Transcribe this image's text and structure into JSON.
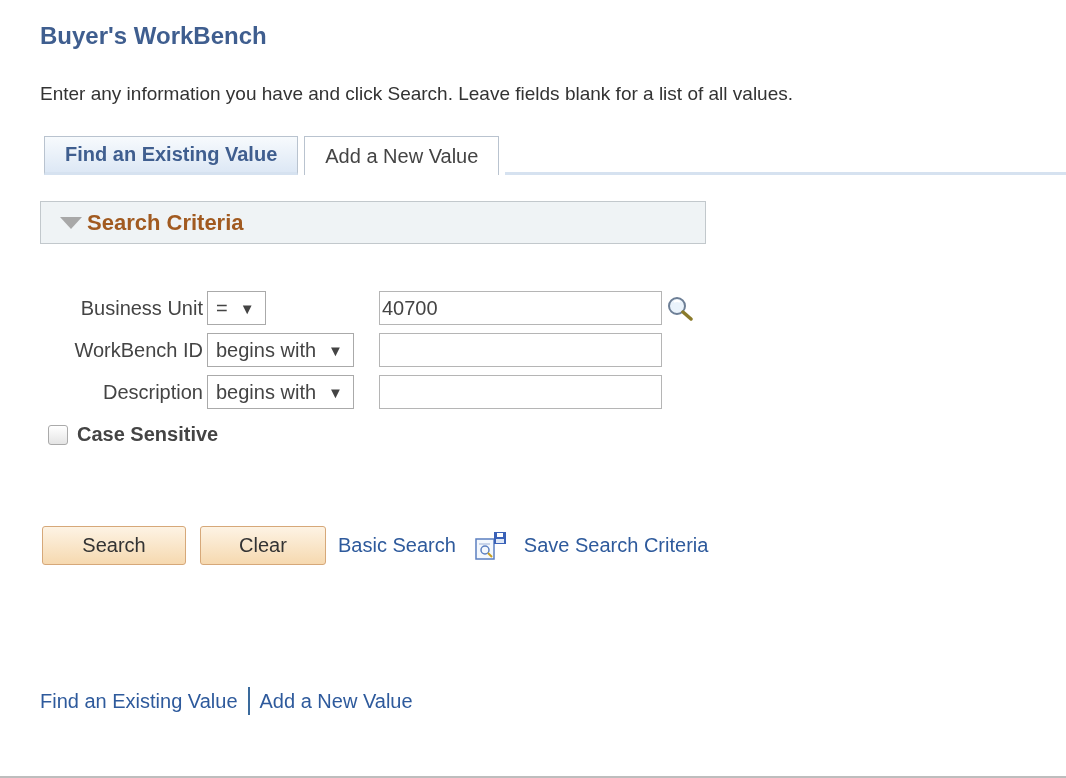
{
  "page": {
    "title": "Buyer's WorkBench",
    "instructions": "Enter any information you have and click Search. Leave fields blank for a list of all values."
  },
  "tabs": [
    {
      "label": "Find an Existing Value",
      "selected": true
    },
    {
      "label": "Add a New Value",
      "selected": false
    }
  ],
  "section": {
    "title": "Search Criteria",
    "expanded": true
  },
  "fields": [
    {
      "label": "Business Unit",
      "operator": "=",
      "operator_arrow": "▼",
      "value": "40700",
      "lookup": true
    },
    {
      "label": "WorkBench ID",
      "operator": "begins with",
      "operator_arrow": "▼",
      "lookup": false
    },
    {
      "label": "Description",
      "operator": "begins with",
      "operator_arrow": "▼",
      "lookup": false
    }
  ],
  "case_sensitive": {
    "label": "Case Sensitive",
    "checked": false
  },
  "buttons": [
    "Search",
    "Clear"
  ],
  "basic_search_link": "Basic Search",
  "save_criteria_link": "Save Search Criteria",
  "footer_links": [
    "Find an Existing Value",
    "Add a New Value"
  ]
}
